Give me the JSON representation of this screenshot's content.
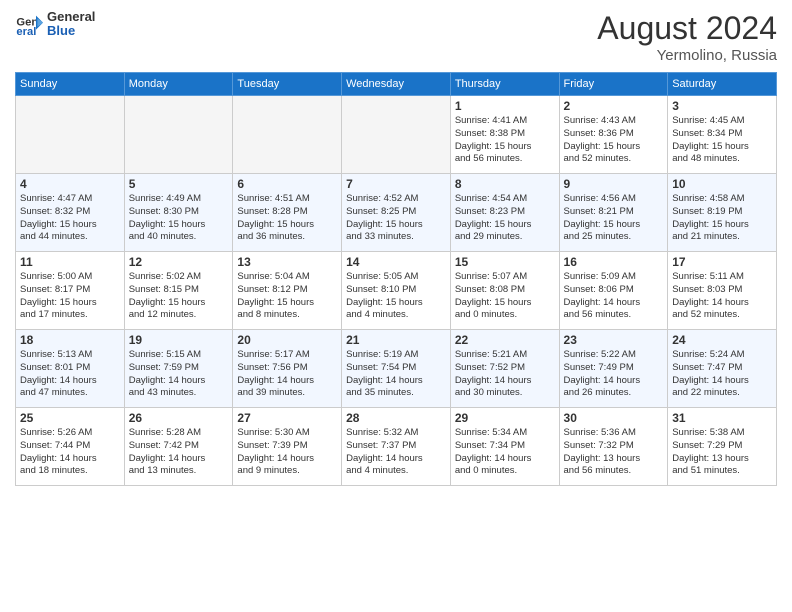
{
  "header": {
    "logo_general": "General",
    "logo_blue": "Blue",
    "month_year": "August 2024",
    "location": "Yermolino, Russia"
  },
  "days_of_week": [
    "Sunday",
    "Monday",
    "Tuesday",
    "Wednesday",
    "Thursday",
    "Friday",
    "Saturday"
  ],
  "weeks": [
    [
      {
        "day": "",
        "info": ""
      },
      {
        "day": "",
        "info": ""
      },
      {
        "day": "",
        "info": ""
      },
      {
        "day": "",
        "info": ""
      },
      {
        "day": "1",
        "info": "Sunrise: 4:41 AM\nSunset: 8:38 PM\nDaylight: 15 hours\nand 56 minutes."
      },
      {
        "day": "2",
        "info": "Sunrise: 4:43 AM\nSunset: 8:36 PM\nDaylight: 15 hours\nand 52 minutes."
      },
      {
        "day": "3",
        "info": "Sunrise: 4:45 AM\nSunset: 8:34 PM\nDaylight: 15 hours\nand 48 minutes."
      }
    ],
    [
      {
        "day": "4",
        "info": "Sunrise: 4:47 AM\nSunset: 8:32 PM\nDaylight: 15 hours\nand 44 minutes."
      },
      {
        "day": "5",
        "info": "Sunrise: 4:49 AM\nSunset: 8:30 PM\nDaylight: 15 hours\nand 40 minutes."
      },
      {
        "day": "6",
        "info": "Sunrise: 4:51 AM\nSunset: 8:28 PM\nDaylight: 15 hours\nand 36 minutes."
      },
      {
        "day": "7",
        "info": "Sunrise: 4:52 AM\nSunset: 8:25 PM\nDaylight: 15 hours\nand 33 minutes."
      },
      {
        "day": "8",
        "info": "Sunrise: 4:54 AM\nSunset: 8:23 PM\nDaylight: 15 hours\nand 29 minutes."
      },
      {
        "day": "9",
        "info": "Sunrise: 4:56 AM\nSunset: 8:21 PM\nDaylight: 15 hours\nand 25 minutes."
      },
      {
        "day": "10",
        "info": "Sunrise: 4:58 AM\nSunset: 8:19 PM\nDaylight: 15 hours\nand 21 minutes."
      }
    ],
    [
      {
        "day": "11",
        "info": "Sunrise: 5:00 AM\nSunset: 8:17 PM\nDaylight: 15 hours\nand 17 minutes."
      },
      {
        "day": "12",
        "info": "Sunrise: 5:02 AM\nSunset: 8:15 PM\nDaylight: 15 hours\nand 12 minutes."
      },
      {
        "day": "13",
        "info": "Sunrise: 5:04 AM\nSunset: 8:12 PM\nDaylight: 15 hours\nand 8 minutes."
      },
      {
        "day": "14",
        "info": "Sunrise: 5:05 AM\nSunset: 8:10 PM\nDaylight: 15 hours\nand 4 minutes."
      },
      {
        "day": "15",
        "info": "Sunrise: 5:07 AM\nSunset: 8:08 PM\nDaylight: 15 hours\nand 0 minutes."
      },
      {
        "day": "16",
        "info": "Sunrise: 5:09 AM\nSunset: 8:06 PM\nDaylight: 14 hours\nand 56 minutes."
      },
      {
        "day": "17",
        "info": "Sunrise: 5:11 AM\nSunset: 8:03 PM\nDaylight: 14 hours\nand 52 minutes."
      }
    ],
    [
      {
        "day": "18",
        "info": "Sunrise: 5:13 AM\nSunset: 8:01 PM\nDaylight: 14 hours\nand 47 minutes."
      },
      {
        "day": "19",
        "info": "Sunrise: 5:15 AM\nSunset: 7:59 PM\nDaylight: 14 hours\nand 43 minutes."
      },
      {
        "day": "20",
        "info": "Sunrise: 5:17 AM\nSunset: 7:56 PM\nDaylight: 14 hours\nand 39 minutes."
      },
      {
        "day": "21",
        "info": "Sunrise: 5:19 AM\nSunset: 7:54 PM\nDaylight: 14 hours\nand 35 minutes."
      },
      {
        "day": "22",
        "info": "Sunrise: 5:21 AM\nSunset: 7:52 PM\nDaylight: 14 hours\nand 30 minutes."
      },
      {
        "day": "23",
        "info": "Sunrise: 5:22 AM\nSunset: 7:49 PM\nDaylight: 14 hours\nand 26 minutes."
      },
      {
        "day": "24",
        "info": "Sunrise: 5:24 AM\nSunset: 7:47 PM\nDaylight: 14 hours\nand 22 minutes."
      }
    ],
    [
      {
        "day": "25",
        "info": "Sunrise: 5:26 AM\nSunset: 7:44 PM\nDaylight: 14 hours\nand 18 minutes."
      },
      {
        "day": "26",
        "info": "Sunrise: 5:28 AM\nSunset: 7:42 PM\nDaylight: 14 hours\nand 13 minutes."
      },
      {
        "day": "27",
        "info": "Sunrise: 5:30 AM\nSunset: 7:39 PM\nDaylight: 14 hours\nand 9 minutes."
      },
      {
        "day": "28",
        "info": "Sunrise: 5:32 AM\nSunset: 7:37 PM\nDaylight: 14 hours\nand 4 minutes."
      },
      {
        "day": "29",
        "info": "Sunrise: 5:34 AM\nSunset: 7:34 PM\nDaylight: 14 hours\nand 0 minutes."
      },
      {
        "day": "30",
        "info": "Sunrise: 5:36 AM\nSunset: 7:32 PM\nDaylight: 13 hours\nand 56 minutes."
      },
      {
        "day": "31",
        "info": "Sunrise: 5:38 AM\nSunset: 7:29 PM\nDaylight: 13 hours\nand 51 minutes."
      }
    ]
  ]
}
